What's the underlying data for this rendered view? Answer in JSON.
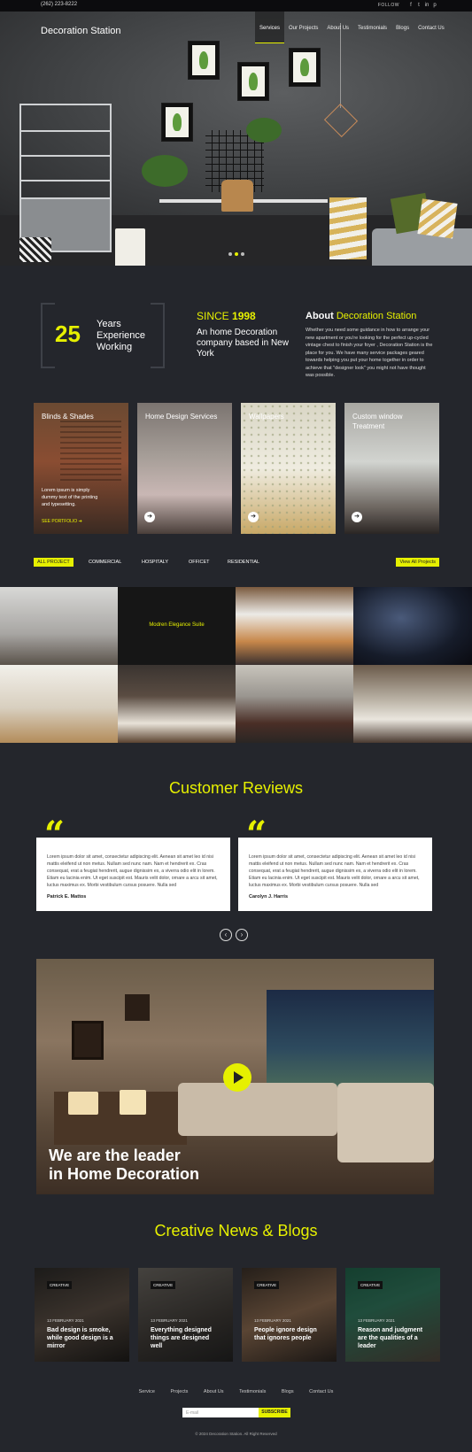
{
  "topbar": {
    "phone": "(262) 223-8222",
    "follow_label": "FOLLOW",
    "social": [
      "f",
      "t",
      "in",
      "p"
    ]
  },
  "header": {
    "brand": "Decoration Station",
    "nav": [
      "Services",
      "Our Projects",
      "About Us",
      "Testimonials",
      "Blogs",
      "Contact Us"
    ],
    "active_nav": "Services"
  },
  "hero": {
    "slide_count": 3,
    "active_slide": 2
  },
  "experience": {
    "number": "25",
    "text": "Years Experience Working"
  },
  "since": {
    "prefix": "SINCE",
    "year": "1998",
    "text": "An home Decoration company based in New York"
  },
  "about": {
    "heading_prefix": "About",
    "heading_suffix": "Decoration Station",
    "text": "Whether you need some guidance in how to arrange your new apartment or you're looking for the perfect up-cycled vintage chest to finish your foyer , Decoration Station is the place for you. We have many service packages geared towards helping you put your home together in order to achieve that \"designer look\" you might not have thought was possible."
  },
  "services": [
    {
      "title": "Blinds & Shades",
      "desc": "Lorem ipsum is simply dummy text of the printing and typesetting.",
      "link": "SEE PORTFOLIO"
    },
    {
      "title": "Home Design Services"
    },
    {
      "title": "Wallpapers"
    },
    {
      "title": "Custom window Treatment"
    }
  ],
  "projects": {
    "filters": [
      "ALL PROJECT",
      "COMMERCIAL",
      "HOSPITALY",
      "OFFICET",
      "RESIDENTIAL"
    ],
    "active_filter": "ALL PROJECT",
    "view_all": "View All Projects",
    "caption": "Modren Elegance Suite"
  },
  "reviews": {
    "heading": "Customer Reviews",
    "items": [
      {
        "text": "Lorem ipsum dolor sit amet, consectetur adipiscing elit. Aenean sit amet leo id nisi mattis eleifend ut non metus. Nullam sed nunc nam. Nam et hendrerit ex. Cras consequat, erat a feugiat hendrerit, augue dignissim ex, a viverra odio elit in lorem. Etiam eu lacinia enim. Ut eget suscipit est. Mauris velit dolor, ornare a arcu sit amet, luctus maximus ex. Morbi vestibulum cursus posuere. Nulla sed",
        "name": "Patrick E. Mattos"
      },
      {
        "text": "Lorem ipsum dolor sit amet, consectetur adipiscing elit. Aenean sit amet leo id nisi mattis eleifend ut non metus. Nullam sed nunc nam. Nam et hendrerit ex. Cras consequat, erat a feugiat hendrerit, augue dignissim ex, a viverra odio elit in lorem. Etiam eu lacinia enim. Ut eget suscipit est. Mauris velit dolor, ornare a arcu sit amet, luctus maximus ex. Morbi vestibulum cursus posuere. Nulla sed",
        "name": "Carolyn J. Harris"
      }
    ],
    "prev_icon": "‹",
    "next_icon": "›"
  },
  "video": {
    "headline_1": "We are the leader",
    "headline_2": "in Home Decoration"
  },
  "blogs": {
    "heading": "Creative News & Blogs",
    "items": [
      {
        "badge": "CREATIVE",
        "date": "13 FEBRUARY 2021",
        "title": "Bad design is smoke, while good design is a mirror"
      },
      {
        "badge": "CREATIVE",
        "date": "13 FEBRUARY 2021",
        "title": "Everything designed things are designed well"
      },
      {
        "badge": "CREATIVE",
        "date": "13 FEBRUARY 2021",
        "title": "People ignore design that ignores people"
      },
      {
        "badge": "CREATIVE",
        "date": "13 FEBRUARY 2021",
        "title": "Reason and judgment are the qualities of a leader"
      }
    ]
  },
  "footer": {
    "nav": [
      "Service",
      "Projects",
      "About Us",
      "Testimonials",
      "Blogs",
      "Contact Us"
    ],
    "email_placeholder": "E-mail",
    "subscribe": "SUBSCRIBE",
    "copyright": "© 2024 Decoration Station. All Right Reserved"
  },
  "colors": {
    "accent": "#e6f000",
    "background": "#24262c"
  }
}
